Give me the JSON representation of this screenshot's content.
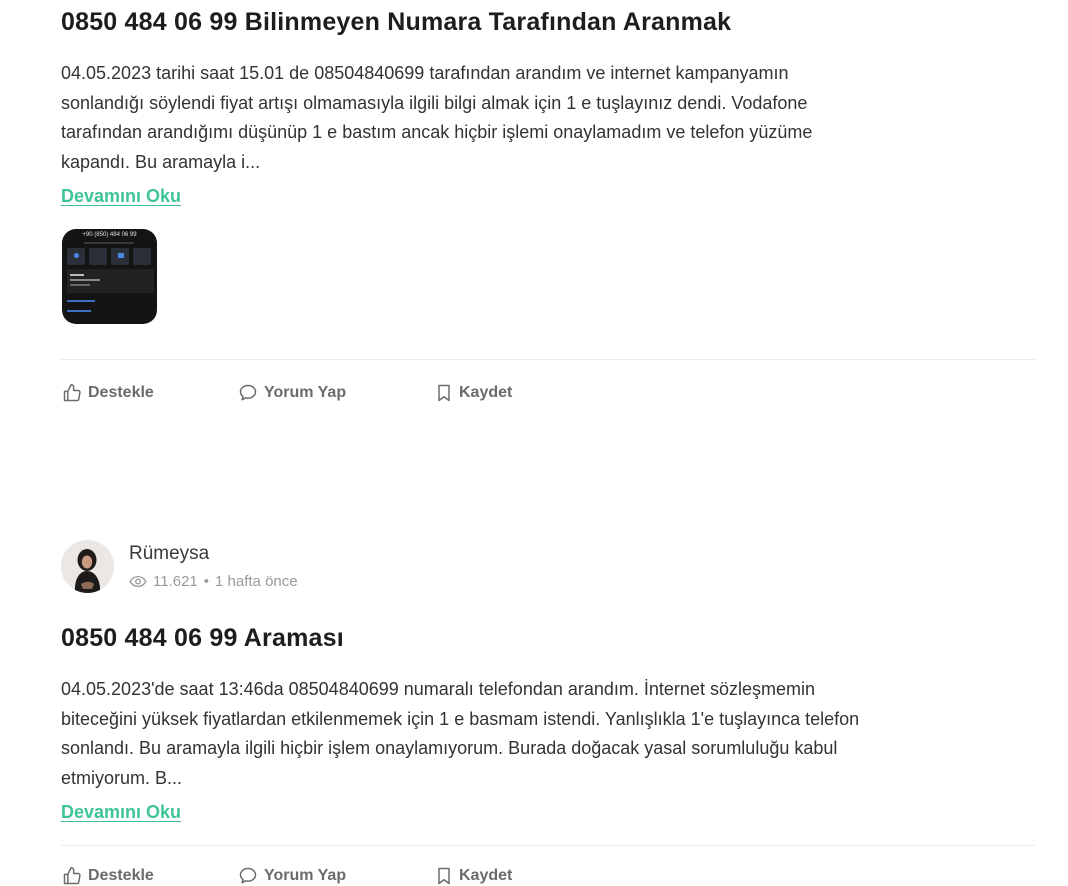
{
  "posts": [
    {
      "title": "0850 484 06 99 Bilinmeyen Numara Tarafından Aranmak",
      "body": [
        "04.05.2023 tarihi saat 15.01 de 08504840699 tarafından arandım ve internet kampanyamın",
        "sonlandığı söylendi fiyat artışı olmamasıyla ilgili bilgi almak için 1 e tuşlayınız dendi. Vodafone",
        "tarafından arandığımı düşünüp 1 e bastım ancak hiçbir işlemi onaylamadım ve telefon yüzüme",
        "kapandı. Bu aramayla i..."
      ],
      "read_more": "Devamını Oku",
      "attachment_caption": "+90 (850) 484 06 99",
      "actions": {
        "support": "Destekle",
        "comment": "Yorum Yap",
        "save": "Kaydet"
      }
    },
    {
      "author": {
        "name": "Rümeysa",
        "views": "11.621",
        "separator": "•",
        "time": "1 hafta önce"
      },
      "title": "0850 484 06 99 Araması",
      "body": [
        "04.05.2023'de saat 13:46da 08504840699 numaralı telefondan arandım. İnternet sözleşmemin",
        "biteceğini yüksek fiyatlardan etkilenmemek için 1 e basmam istendi. Yanlışlıkla 1'e tuşlayınca telefon",
        "sonlandı. Bu aramayla ilgili hiçbir işlem onaylamıyorum. Burada doğacak yasal sorumluluğu kabul",
        "etmiyorum. B..."
      ],
      "read_more": "Devamını Oku",
      "actions": {
        "support": "Destekle",
        "comment": "Yorum Yap",
        "save": "Kaydet"
      }
    }
  ],
  "colors": {
    "accent": "#3ec497",
    "text": "#333333",
    "muted": "#9a9a9a",
    "action": "#6b6b6b"
  },
  "icons": [
    "thumbs-up-icon",
    "comment-icon",
    "bookmark-icon",
    "eye-icon"
  ]
}
